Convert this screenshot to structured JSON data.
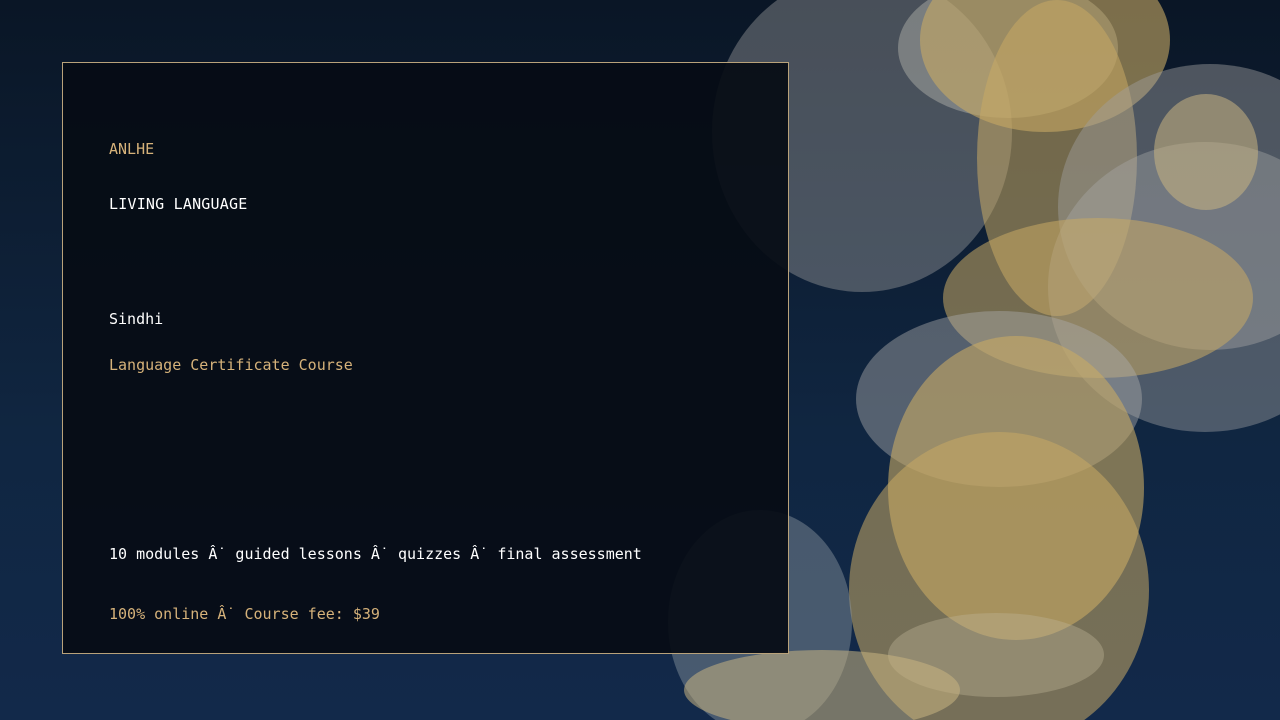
{
  "brand": "ANLHE",
  "kicker": "LIVING LANGUAGE",
  "language": "Sindhi",
  "course_type": "Language Certificate Course",
  "details": "10 modules Â˙ guided lessons Â˙ quizzes Â˙ final assessment",
  "pricing": "100% online Â˙ Course fee: $39",
  "colors": {
    "background": "#0f2440",
    "card": "#060c14",
    "accent_gold": "#d6b27a",
    "border": "#b9a27a",
    "text": "#ffffff"
  }
}
